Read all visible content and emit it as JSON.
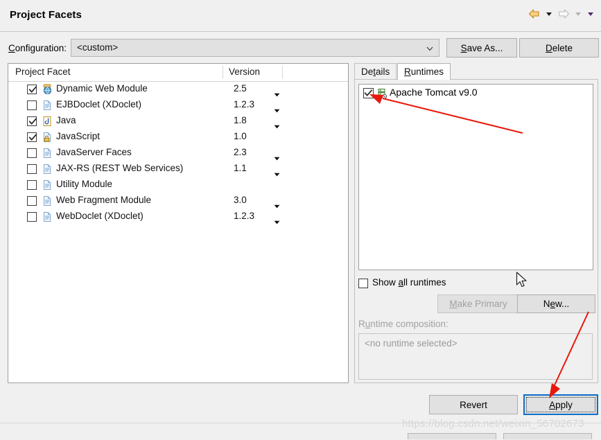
{
  "window": {
    "title": "Project Facets",
    "nav": {
      "back_icon": "back-arrow-icon",
      "back_menu_icon": "chevron-down-icon",
      "forward_icon": "forward-arrow-icon",
      "forward_menu_icon": "chevron-down-icon",
      "extra_menu_icon": "chevron-down-icon"
    }
  },
  "configuration": {
    "label": "Configuration:",
    "label_mnemonic": "C",
    "label_rest": "onfiguration:",
    "value": "<custom>",
    "caret_icon": "chevron-down-icon",
    "save_as_mnemonic": "S",
    "save_as_rest": "ave As...",
    "delete_mnemonic": "D",
    "delete_rest": "elete"
  },
  "facets_table": {
    "columns": [
      "Project Facet",
      "Version",
      ""
    ],
    "rows": [
      {
        "checked": true,
        "icon": "web-module-icon",
        "label": "Dynamic Web Module",
        "version": "2.5",
        "has_version_menu": true
      },
      {
        "checked": false,
        "icon": "document-icon",
        "label": "EJBDoclet (XDoclet)",
        "version": "1.2.3",
        "has_version_menu": true
      },
      {
        "checked": true,
        "icon": "java-document-icon",
        "label": "Java",
        "version": "1.8",
        "has_version_menu": true
      },
      {
        "checked": true,
        "icon": "javascript-lock-icon",
        "label": "JavaScript",
        "version": "1.0",
        "has_version_menu": false
      },
      {
        "checked": false,
        "icon": "document-icon",
        "label": "JavaServer Faces",
        "version": "2.3",
        "has_version_menu": true
      },
      {
        "checked": false,
        "icon": "document-icon",
        "label": "JAX-RS (REST Web Services)",
        "version": "1.1",
        "has_version_menu": true
      },
      {
        "checked": false,
        "icon": "document-icon",
        "label": "Utility Module",
        "version": "",
        "has_version_menu": false
      },
      {
        "checked": false,
        "icon": "document-icon",
        "label": "Web Fragment Module",
        "version": "3.0",
        "has_version_menu": true
      },
      {
        "checked": false,
        "icon": "document-icon",
        "label": "WebDoclet (XDoclet)",
        "version": "1.2.3",
        "has_version_menu": true
      }
    ]
  },
  "right_panel": {
    "tabs": [
      {
        "mnemonic_pre": "De",
        "mnemonic": "t",
        "mnemonic_post": "ails",
        "label": "Details",
        "active": false
      },
      {
        "mnemonic_pre": "",
        "mnemonic": "R",
        "mnemonic_post": "untimes",
        "label": "Runtimes",
        "active": true
      }
    ],
    "runtimes": [
      {
        "checked": true,
        "icon": "server-runtime-icon",
        "label": "Apache Tomcat v9.0"
      }
    ],
    "show_all_runtimes": {
      "checked": false,
      "pre": "Show ",
      "mnemonic": "a",
      "post": "ll runtimes"
    },
    "make_primary": {
      "pre": "",
      "mnemonic": "M",
      "post": "ake Primary",
      "label": "Make Primary",
      "enabled": false
    },
    "new_button": {
      "pre": "N",
      "mnemonic": "e",
      "post": "w...",
      "label": "New...",
      "enabled": true
    },
    "runtime_composition": {
      "pre": "R",
      "mnemonic": "u",
      "post": "ntime composition:",
      "label": "Runtime composition:",
      "value": "<no runtime selected>"
    }
  },
  "footer": {
    "revert_label": "Revert",
    "apply_pre": "",
    "apply_mnemonic": "A",
    "apply_post": "pply",
    "apply_label": "Apply",
    "apply_focused": true
  },
  "watermark": {
    "text": "https://blog.csdn.net/weixin_56702673"
  },
  "colors": {
    "dialog_bg": "#f0f0f0",
    "field_bg": "#e1e1e1",
    "white": "#ffffff",
    "focus_border": "#0d6ec9",
    "annotation_red": "#e8180c",
    "disabled_text": "#a0a0a0",
    "back_arrow": "#e8a020",
    "forward_arrow": "#c8c8c8"
  }
}
